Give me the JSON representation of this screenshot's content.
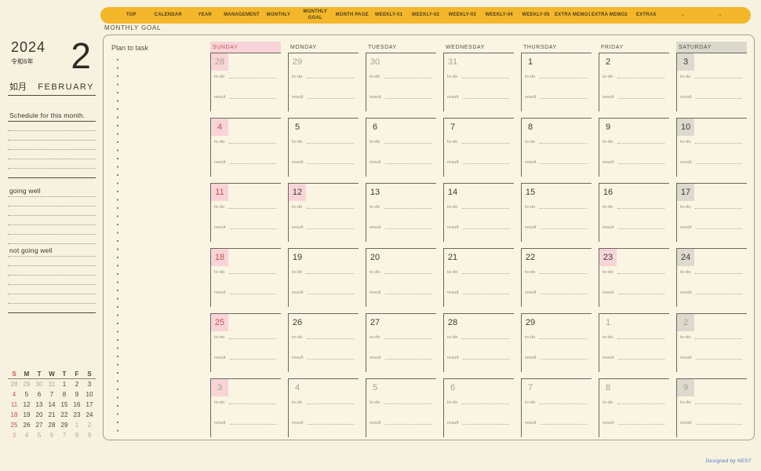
{
  "nav": {
    "tabs": [
      "TOP",
      "CALENDAR",
      "YEAR",
      "MANAGEMENT",
      "MONTHLY",
      "MONTHLY\nGOAL",
      "MONTH PAGE",
      "WEEKLY-01",
      "WEEKLY-02",
      "WEEKLY-03",
      "WEEKLY-04",
      "WEEKLY-05",
      "EXTRA MEMO1",
      "EXTRA MEMO2",
      "EXTRAS",
      "←",
      "→"
    ]
  },
  "page_title": "MONTHLY GOAL",
  "sidebar": {
    "year": "2024",
    "era": "令和6年",
    "month_number": "2",
    "month_jp": "如月",
    "month_en": "FEBRUARY",
    "schedule_label": "Schedule for this month.",
    "going_well_label": "going well",
    "not_going_well_label": "not going well",
    "mini_calendar": {
      "day_headers": [
        "S",
        "M",
        "T",
        "W",
        "T",
        "F",
        "S"
      ],
      "rows": [
        [
          {
            "d": "28",
            "c": "dim"
          },
          {
            "d": "29",
            "c": "dim"
          },
          {
            "d": "30",
            "c": "dim"
          },
          {
            "d": "31",
            "c": "dim"
          },
          {
            "d": "1",
            "c": "dark"
          },
          {
            "d": "2",
            "c": "dark"
          },
          {
            "d": "3",
            "c": "dark"
          }
        ],
        [
          {
            "d": "4",
            "c": "red"
          },
          {
            "d": "5",
            "c": "dark"
          },
          {
            "d": "6",
            "c": "dark"
          },
          {
            "d": "7",
            "c": "dark"
          },
          {
            "d": "8",
            "c": "dark"
          },
          {
            "d": "9",
            "c": "dark"
          },
          {
            "d": "10",
            "c": "dark"
          }
        ],
        [
          {
            "d": "11",
            "c": "red"
          },
          {
            "d": "12",
            "c": "dark"
          },
          {
            "d": "13",
            "c": "dark"
          },
          {
            "d": "14",
            "c": "dark"
          },
          {
            "d": "15",
            "c": "dark"
          },
          {
            "d": "16",
            "c": "dark"
          },
          {
            "d": "17",
            "c": "dark"
          }
        ],
        [
          {
            "d": "18",
            "c": "red"
          },
          {
            "d": "19",
            "c": "dark"
          },
          {
            "d": "20",
            "c": "dark"
          },
          {
            "d": "21",
            "c": "dark"
          },
          {
            "d": "22",
            "c": "dark"
          },
          {
            "d": "23",
            "c": "dark"
          },
          {
            "d": "24",
            "c": "dark"
          }
        ],
        [
          {
            "d": "25",
            "c": "red"
          },
          {
            "d": "26",
            "c": "dark"
          },
          {
            "d": "27",
            "c": "dark"
          },
          {
            "d": "28",
            "c": "dark"
          },
          {
            "d": "29",
            "c": "dark"
          },
          {
            "d": "1",
            "c": "dim"
          },
          {
            "d": "2",
            "c": "dim"
          }
        ],
        [
          {
            "d": "3",
            "c": "dimred"
          },
          {
            "d": "4",
            "c": "dim"
          },
          {
            "d": "5",
            "c": "dim"
          },
          {
            "d": "6",
            "c": "dim"
          },
          {
            "d": "7",
            "c": "dim"
          },
          {
            "d": "8",
            "c": "dim"
          },
          {
            "d": "9",
            "c": "dim"
          }
        ]
      ]
    }
  },
  "main": {
    "plan_label": "Plan to task",
    "day_headers": [
      {
        "label": "SUNDAY",
        "style": "sun"
      },
      {
        "label": "MONDAY",
        "style": "plain"
      },
      {
        "label": "TUESDAY",
        "style": "plain"
      },
      {
        "label": "WEDNESDAY",
        "style": "plain"
      },
      {
        "label": "THURSDAY",
        "style": "plain"
      },
      {
        "label": "FRIDAY",
        "style": "plain"
      },
      {
        "label": "SATURDAY",
        "style": "sat"
      }
    ],
    "cell_labels": {
      "todo": "to-do",
      "result": "result"
    },
    "weeks": [
      [
        {
          "date": "28",
          "tone": "dim",
          "bg": "pink"
        },
        {
          "date": "29",
          "tone": "dim",
          "bg": "none"
        },
        {
          "date": "30",
          "tone": "dim",
          "bg": "none"
        },
        {
          "date": "31",
          "tone": "dim",
          "bg": "none"
        },
        {
          "date": "1",
          "tone": "dark",
          "bg": "none"
        },
        {
          "date": "2",
          "tone": "dark",
          "bg": "none"
        },
        {
          "date": "3",
          "tone": "dark",
          "bg": "gray"
        }
      ],
      [
        {
          "date": "4",
          "tone": "red",
          "bg": "pink"
        },
        {
          "date": "5",
          "tone": "dark",
          "bg": "none"
        },
        {
          "date": "6",
          "tone": "dark",
          "bg": "none"
        },
        {
          "date": "7",
          "tone": "dark",
          "bg": "none"
        },
        {
          "date": "8",
          "tone": "dark",
          "bg": "none"
        },
        {
          "date": "9",
          "tone": "dark",
          "bg": "none"
        },
        {
          "date": "10",
          "tone": "dark",
          "bg": "gray"
        }
      ],
      [
        {
          "date": "11",
          "tone": "red",
          "bg": "pink"
        },
        {
          "date": "12",
          "tone": "dark",
          "bg": "pink"
        },
        {
          "date": "13",
          "tone": "dark",
          "bg": "none"
        },
        {
          "date": "14",
          "tone": "dark",
          "bg": "none"
        },
        {
          "date": "15",
          "tone": "dark",
          "bg": "none"
        },
        {
          "date": "16",
          "tone": "dark",
          "bg": "none"
        },
        {
          "date": "17",
          "tone": "dark",
          "bg": "gray"
        }
      ],
      [
        {
          "date": "18",
          "tone": "red",
          "bg": "pink"
        },
        {
          "date": "19",
          "tone": "dark",
          "bg": "none"
        },
        {
          "date": "20",
          "tone": "dark",
          "bg": "none"
        },
        {
          "date": "21",
          "tone": "dark",
          "bg": "none"
        },
        {
          "date": "22",
          "tone": "dark",
          "bg": "none"
        },
        {
          "date": "23",
          "tone": "dark",
          "bg": "pink"
        },
        {
          "date": "24",
          "tone": "dark",
          "bg": "gray"
        }
      ],
      [
        {
          "date": "25",
          "tone": "red",
          "bg": "pink"
        },
        {
          "date": "26",
          "tone": "dark",
          "bg": "none"
        },
        {
          "date": "27",
          "tone": "dark",
          "bg": "none"
        },
        {
          "date": "28",
          "tone": "dark",
          "bg": "none"
        },
        {
          "date": "29",
          "tone": "dark",
          "bg": "none"
        },
        {
          "date": "1",
          "tone": "dim",
          "bg": "none"
        },
        {
          "date": "2",
          "tone": "dim",
          "bg": "gray"
        }
      ],
      [
        {
          "date": "3",
          "tone": "dim",
          "bg": "pink"
        },
        {
          "date": "4",
          "tone": "dim",
          "bg": "none"
        },
        {
          "date": "5",
          "tone": "dim",
          "bg": "none"
        },
        {
          "date": "6",
          "tone": "dim",
          "bg": "none"
        },
        {
          "date": "7",
          "tone": "dim",
          "bg": "none"
        },
        {
          "date": "8",
          "tone": "dim",
          "bg": "none"
        },
        {
          "date": "9",
          "tone": "dim",
          "bg": "gray"
        }
      ]
    ]
  },
  "footer": {
    "credit": "Designed by NEST"
  },
  "colors": {
    "nav_yellow": "#f4b72b",
    "sunday_pink": "#f8d4d8",
    "saturday_gray": "#dcdacf",
    "holiday_red": "#c05550",
    "credit_blue": "#4f7ccb",
    "background_cream": "#f7f1df"
  }
}
